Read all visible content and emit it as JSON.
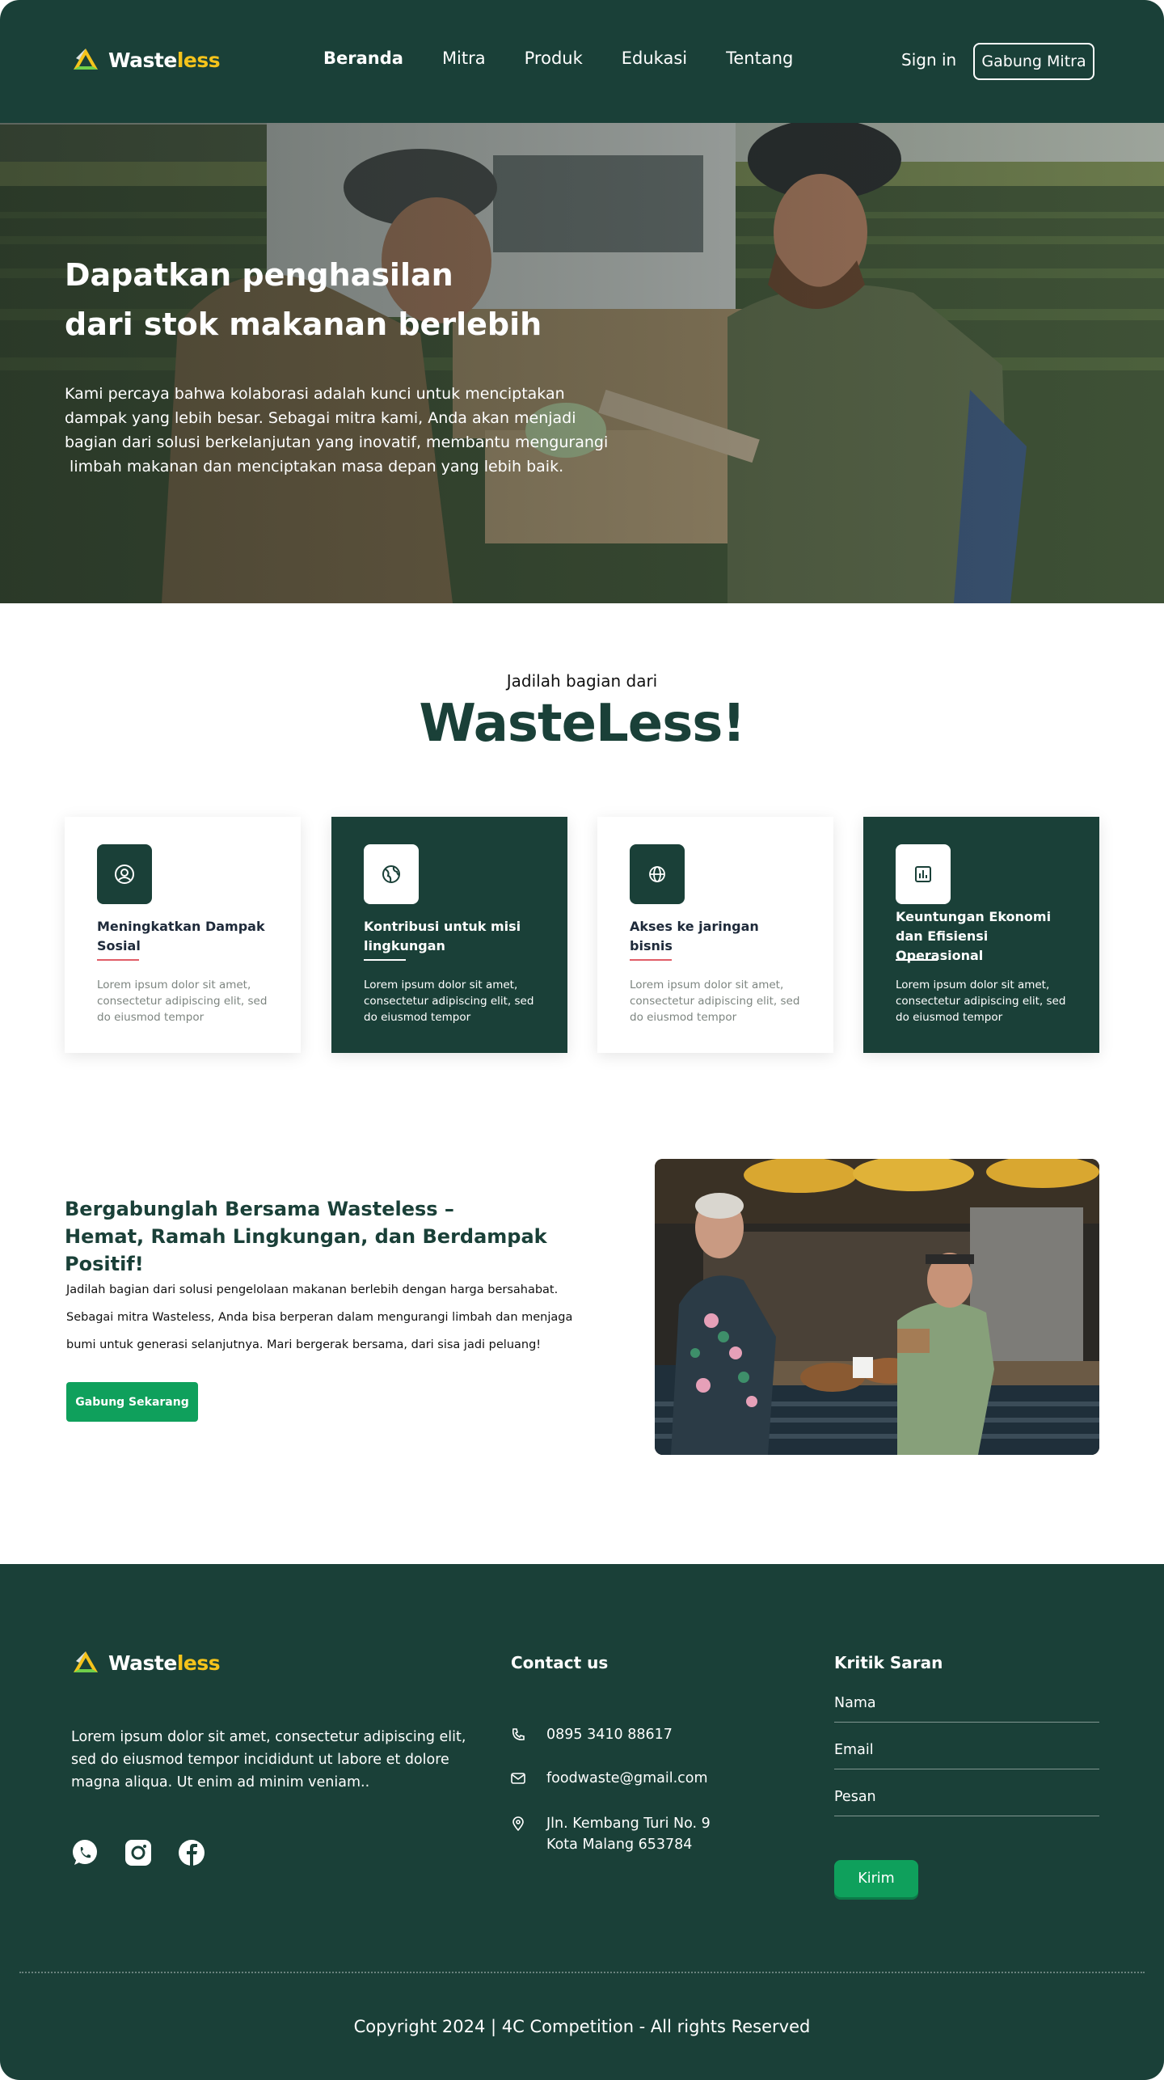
{
  "brand": {
    "name_part1": "Waste",
    "name_part2": "less"
  },
  "nav": {
    "links": [
      "Beranda",
      "Mitra",
      "Produk",
      "Edukasi",
      "Tentang"
    ],
    "active": "Beranda",
    "signin": "Sign in",
    "cta": "Gabung Mitra"
  },
  "hero": {
    "title_line1": "Dapatkan penghasilan",
    "title_line2": "dari stok makanan berlebih",
    "text_lines": [
      "Kami percaya bahwa kolaborasi adalah kunci untuk menciptakan",
      "dampak yang lebih besar. Sebagai mitra kami, Anda akan menjadi",
      "bagian dari solusi berkelanjutan yang inovatif, membantu mengurangi",
      " limbah makanan dan menciptakan masa depan yang lebih baik."
    ]
  },
  "bagian": {
    "eyebrow": "Jadilah bagian dari",
    "title": "WasteLess!",
    "cards": [
      {
        "icon": "user-circle-icon",
        "title": "Meningkatkan Dampak Sosial",
        "text": "Lorem ipsum dolor sit amet, consectetur adipiscing elit, sed do eiusmod tempor",
        "theme": "light"
      },
      {
        "icon": "leaf-globe-icon",
        "title": "Kontribusi untuk misi lingkungan",
        "text": "Lorem ipsum dolor sit amet, consectetur adipiscing elit, sed do eiusmod tempor",
        "theme": "dark"
      },
      {
        "icon": "globe-icon",
        "title": "Akses ke jaringan bisnis",
        "text": "Lorem ipsum dolor sit amet, consectetur adipiscing elit, sed do eiusmod tempor",
        "theme": "light"
      },
      {
        "icon": "bar-chart-icon",
        "title": "Keuntungan Ekonomi dan Efisiensi Operasional",
        "text": "Lorem ipsum dolor sit amet, consectetur adipiscing elit, sed do eiusmod tempor",
        "theme": "dark"
      }
    ]
  },
  "join": {
    "title_line1": "Bergabunglah Bersama Wasteless –",
    "title_line2": "Hemat, Ramah Lingkungan, dan Berdampak Positif!",
    "text_lines": [
      "Jadilah bagian dari solusi pengelolaan makanan berlebih dengan harga bersahabat.",
      "Sebagai mitra Wasteless, Anda bisa berperan dalam mengurangi limbah dan menjaga",
      "bumi untuk generasi selanjutnya. Mari bergerak bersama, dari sisa jadi peluang!"
    ],
    "button": "Gabung Sekarang"
  },
  "footer": {
    "about_lines": [
      "Lorem ipsum dolor sit amet, consectetur adipiscing elit,",
      "sed do eiusmod tempor incididunt ut labore et dolore",
      "magna aliqua. Ut enim ad minim veniam.."
    ],
    "socials": [
      "whatsapp-icon",
      "instagram-icon",
      "facebook-icon"
    ],
    "contact_heading": "Contact us",
    "phone": "0895 3410 88617",
    "email": "foodwaste@gmail.com",
    "address_line1": "Jln. Kembang Turi No. 9",
    "address_line2": "Kota Malang 653784",
    "feedback_heading": "Kritik Saran",
    "fields": [
      "Nama",
      "Email",
      "Pesan"
    ],
    "submit": "Kirim",
    "copyright": "Copyright 2024 | 4C Competition - All rights Reserved"
  },
  "colors": {
    "primary": "#1a4038",
    "accent_yellow": "#f5c31b",
    "button_green": "#0fa05c",
    "underline_red": "#e05d67"
  }
}
